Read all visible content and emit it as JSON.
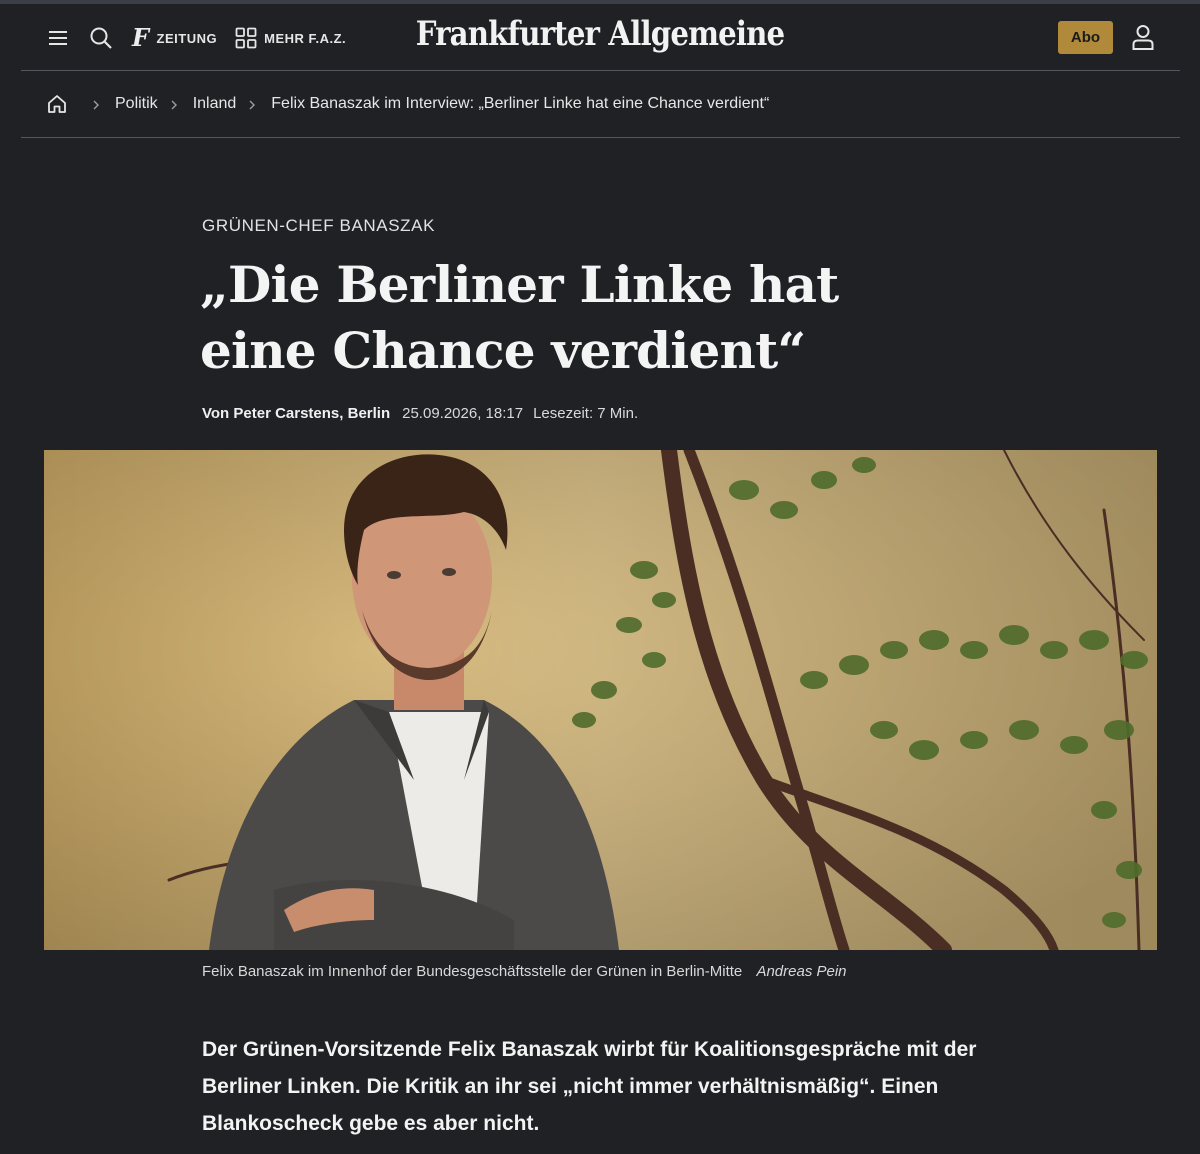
{
  "header": {
    "nav_zeitung": "ZEITUNG",
    "nav_mehr": "MEHR F.A.Z.",
    "logo_text": "Frankfurter Allgemeine",
    "abo_label": "Abo",
    "accent_color": "#b08a3a"
  },
  "breadcrumb": {
    "items": [
      "Politik",
      "Inland",
      "Felix Banaszak im Interview: „Berliner Linke hat eine Chance verdient“"
    ]
  },
  "article": {
    "kicker": "GRÜNEN-CHEF BANASZAK",
    "headline": "„Die Berliner Linke hat eine Chance verdient“",
    "author": "Von Peter Carstens, Berlin",
    "date": "25.09.2026, 18:17",
    "read_time": "Lesezeit: 7 Min.",
    "caption": "Felix Banaszak im Innenhof der Bundesgeschäftsstelle der Grünen in Berlin-Mitte",
    "credit": "Andreas Pein",
    "lead": "Der Grünen-Vorsitzende Felix Banaszak wirbt für Koalitionsgespräche mit der Berliner Linken. Die Kritik an ihr sei „nicht immer verhältnismäßig“. Einen Blankoscheck gebe es aber nicht."
  },
  "icons": {
    "menu": "menu-icon",
    "search": "search-icon",
    "newspaper": "faz-f-icon",
    "grid": "grid-icon",
    "user": "user-icon",
    "home": "home-icon",
    "chevron": "chevron-right-icon"
  }
}
